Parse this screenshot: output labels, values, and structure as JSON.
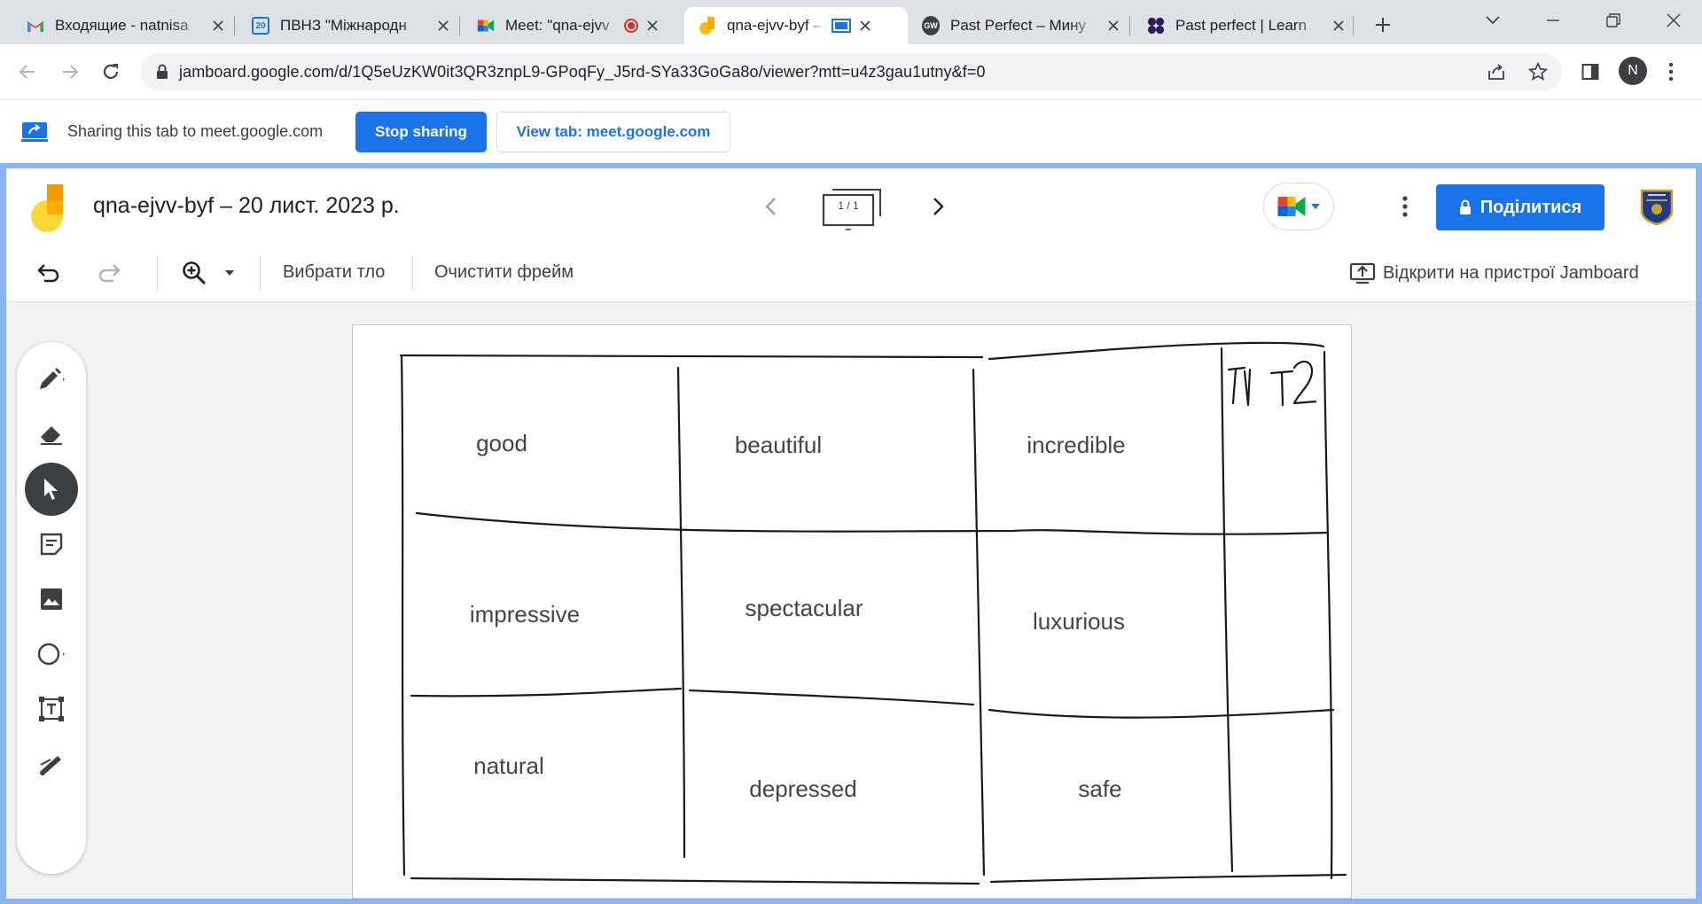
{
  "browser": {
    "tabs": [
      {
        "title": "Входящие - natnisa",
        "favicon": "gmail-icon"
      },
      {
        "title": "ПВНЗ \"Міжнародн",
        "favicon": "calendar-icon",
        "favicon_text": "20"
      },
      {
        "title": "Meet: \"qna-ejvv",
        "favicon": "meet-icon",
        "recording": true
      },
      {
        "title": "qna-ejvv-byf – ",
        "favicon": "jamboard-icon",
        "active": true,
        "sharing": true
      },
      {
        "title": "Past Perfect – Мину",
        "favicon": "gw-icon",
        "favicon_text": "GW"
      },
      {
        "title": "Past perfect | Learn",
        "favicon": "learnenglish-icon"
      }
    ],
    "url": "jamboard.google.com/d/1Q5eUzKW0it3QR3znpL9-GPoqFy_J5rd-SYa33GoGa8o/viewer?mtt=u4z3gau1utny&f=0",
    "profile_initial": "N"
  },
  "sharing_bar": {
    "message": "Sharing this tab to meet.google.com",
    "stop_label": "Stop sharing",
    "view_label": "View tab: meet.google.com"
  },
  "jamboard": {
    "title": "qna-ejvv-byf – 20 лист. 2023 р.",
    "frame_counter": "1 / 1",
    "share_label": "Поділитися",
    "toolbar": {
      "background_label": "Вибрати тло",
      "clear_label": "Очистити фрейм",
      "open_device_label": "Відкрити на пристрої Jamboard"
    },
    "tools": [
      "pen-tool",
      "eraser-tool",
      "select-tool",
      "sticky-note-tool",
      "image-tool",
      "shape-tool",
      "text-box-tool",
      "laser-tool"
    ],
    "active_tool": "select-tool",
    "canvas": {
      "handwritten_label": "T1 T2",
      "words": [
        "good",
        "beautiful",
        "incredible",
        "impressive",
        "spectacular",
        "luxurious",
        "natural",
        "depressed",
        "safe"
      ]
    }
  },
  "colors": {
    "accent": "#1a73e8",
    "share_frame": "#8ab4f8",
    "tab_strip": "#dee1e6"
  }
}
